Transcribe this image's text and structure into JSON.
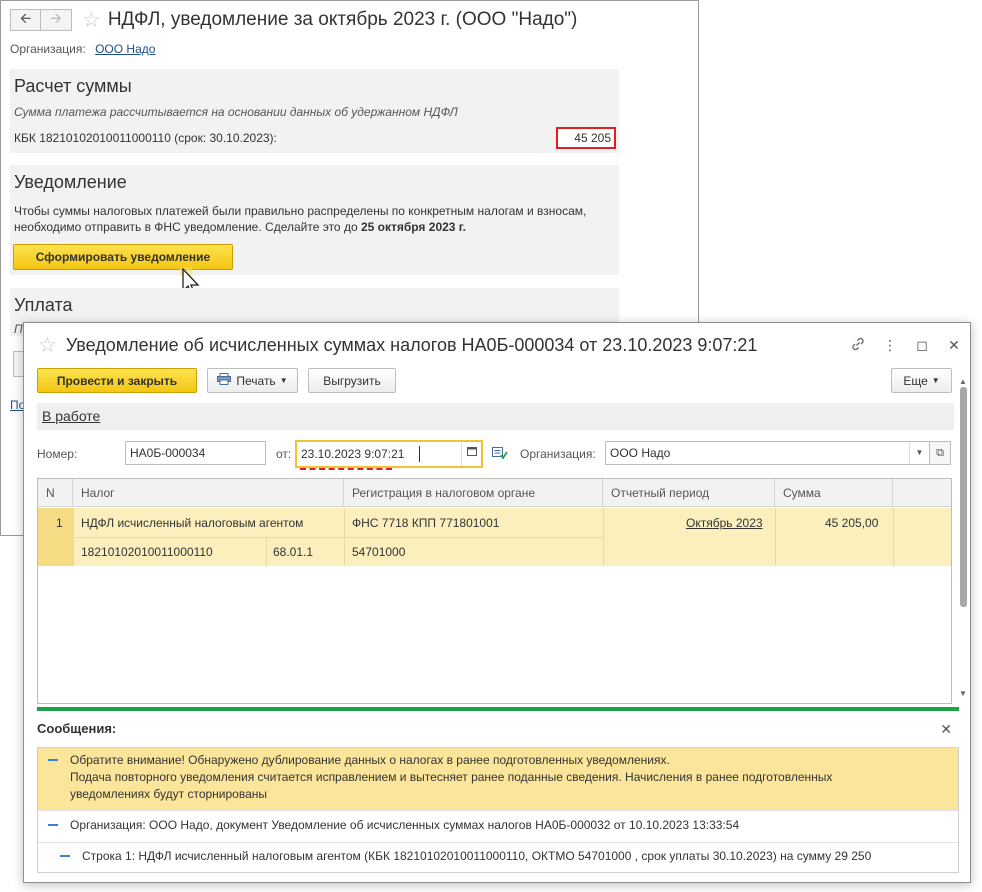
{
  "back_window": {
    "title": "НДФЛ, уведомление за октябрь 2023 г. (ООО \"Надо\")",
    "org_label": "Организация:",
    "org_value": "ООО Надо",
    "calc": {
      "title": "Расчет суммы",
      "note": "Сумма платежа рассчитывается на основании данных об удержанном НДФЛ",
      "kbk_text": "КБК 18210102010011000110 (срок: 30.10.2023):",
      "kbk_sum": "45 205"
    },
    "notice": {
      "title": "Уведомление",
      "text_part1": "Чтобы суммы налоговых платежей были правильно распределены по конкретным налогам и взносам, необходимо отправить в ФНС уведомление. Сделайте это до ",
      "text_bold": "25 октября 2023 г.",
      "button_label": "Сформировать уведомление"
    },
    "payment": {
      "title": "Уплата",
      "clipped_text": "П",
      "clipped_link": "По"
    }
  },
  "front_window": {
    "title": "Уведомление об исчисленных суммах налогов НА0Б-000034 от 23.10.2023 9:07:21",
    "toolbar": {
      "post_close_label": "Провести и закрыть",
      "print_label": "Печать",
      "upload_label": "Выгрузить",
      "more_label": "Еще"
    },
    "status": "В работе",
    "fields": {
      "number_label": "Номер:",
      "number_value": "НА0Б-000034",
      "date_label": "от:",
      "date_value": "23.10.2023  9:07:21",
      "org_label": "Организация:",
      "org_value": "ООО Надо"
    },
    "table": {
      "columns": [
        "N",
        "Налог",
        "Регистрация в налоговом органе",
        "Отчетный период",
        "Сумма"
      ],
      "rows": [
        {
          "n": "1",
          "tax": "НДФЛ исчисленный налоговым агентом",
          "kbk": "18210102010011000110",
          "account": "68.01.1",
          "registration": "ФНС 7718 КПП 771801001",
          "oktmo": "54701000",
          "period": "Октябрь 2023",
          "sum": "45 205,00"
        }
      ]
    },
    "messages": {
      "title": "Сообщения:",
      "warning_line1": "Обратите внимание! Обнаружено дублирование данных о налогах в ранее подготовленных уведомлениях.",
      "warning_line2": "Подача повторного уведомления считается исправлением и вытесняет ранее поданные сведения. Начисления в ранее подготовленных",
      "warning_line3": "уведомлениях будут сторнированы",
      "info_line": "Организация: ООО Надо, документ Уведомление об исчисленных суммах налогов НА0Б-000032 от 10.10.2023 13:33:54",
      "detail_line": "Строка 1: НДФЛ исчисленный налоговым агентом (КБК 18210102010011000110, ОКТМО 54701000    , срок уплаты 30.10.2023) на сумму 29 250"
    }
  },
  "colors": {
    "accent_yellow": "#f5c918",
    "highlight_row": "#fbefbd",
    "error_red": "#e02020",
    "green_bar": "#21a04a",
    "link_blue": "#1c4e8c"
  },
  "icons": [
    "arrow-left-icon",
    "arrow-right-icon",
    "star-icon",
    "link-icon",
    "more-vertical-icon",
    "maximize-icon",
    "close-icon",
    "printer-icon",
    "calendar-icon",
    "document-status-icon",
    "chevron-down-icon",
    "open-form-icon",
    "mouse-cursor-icon"
  ]
}
